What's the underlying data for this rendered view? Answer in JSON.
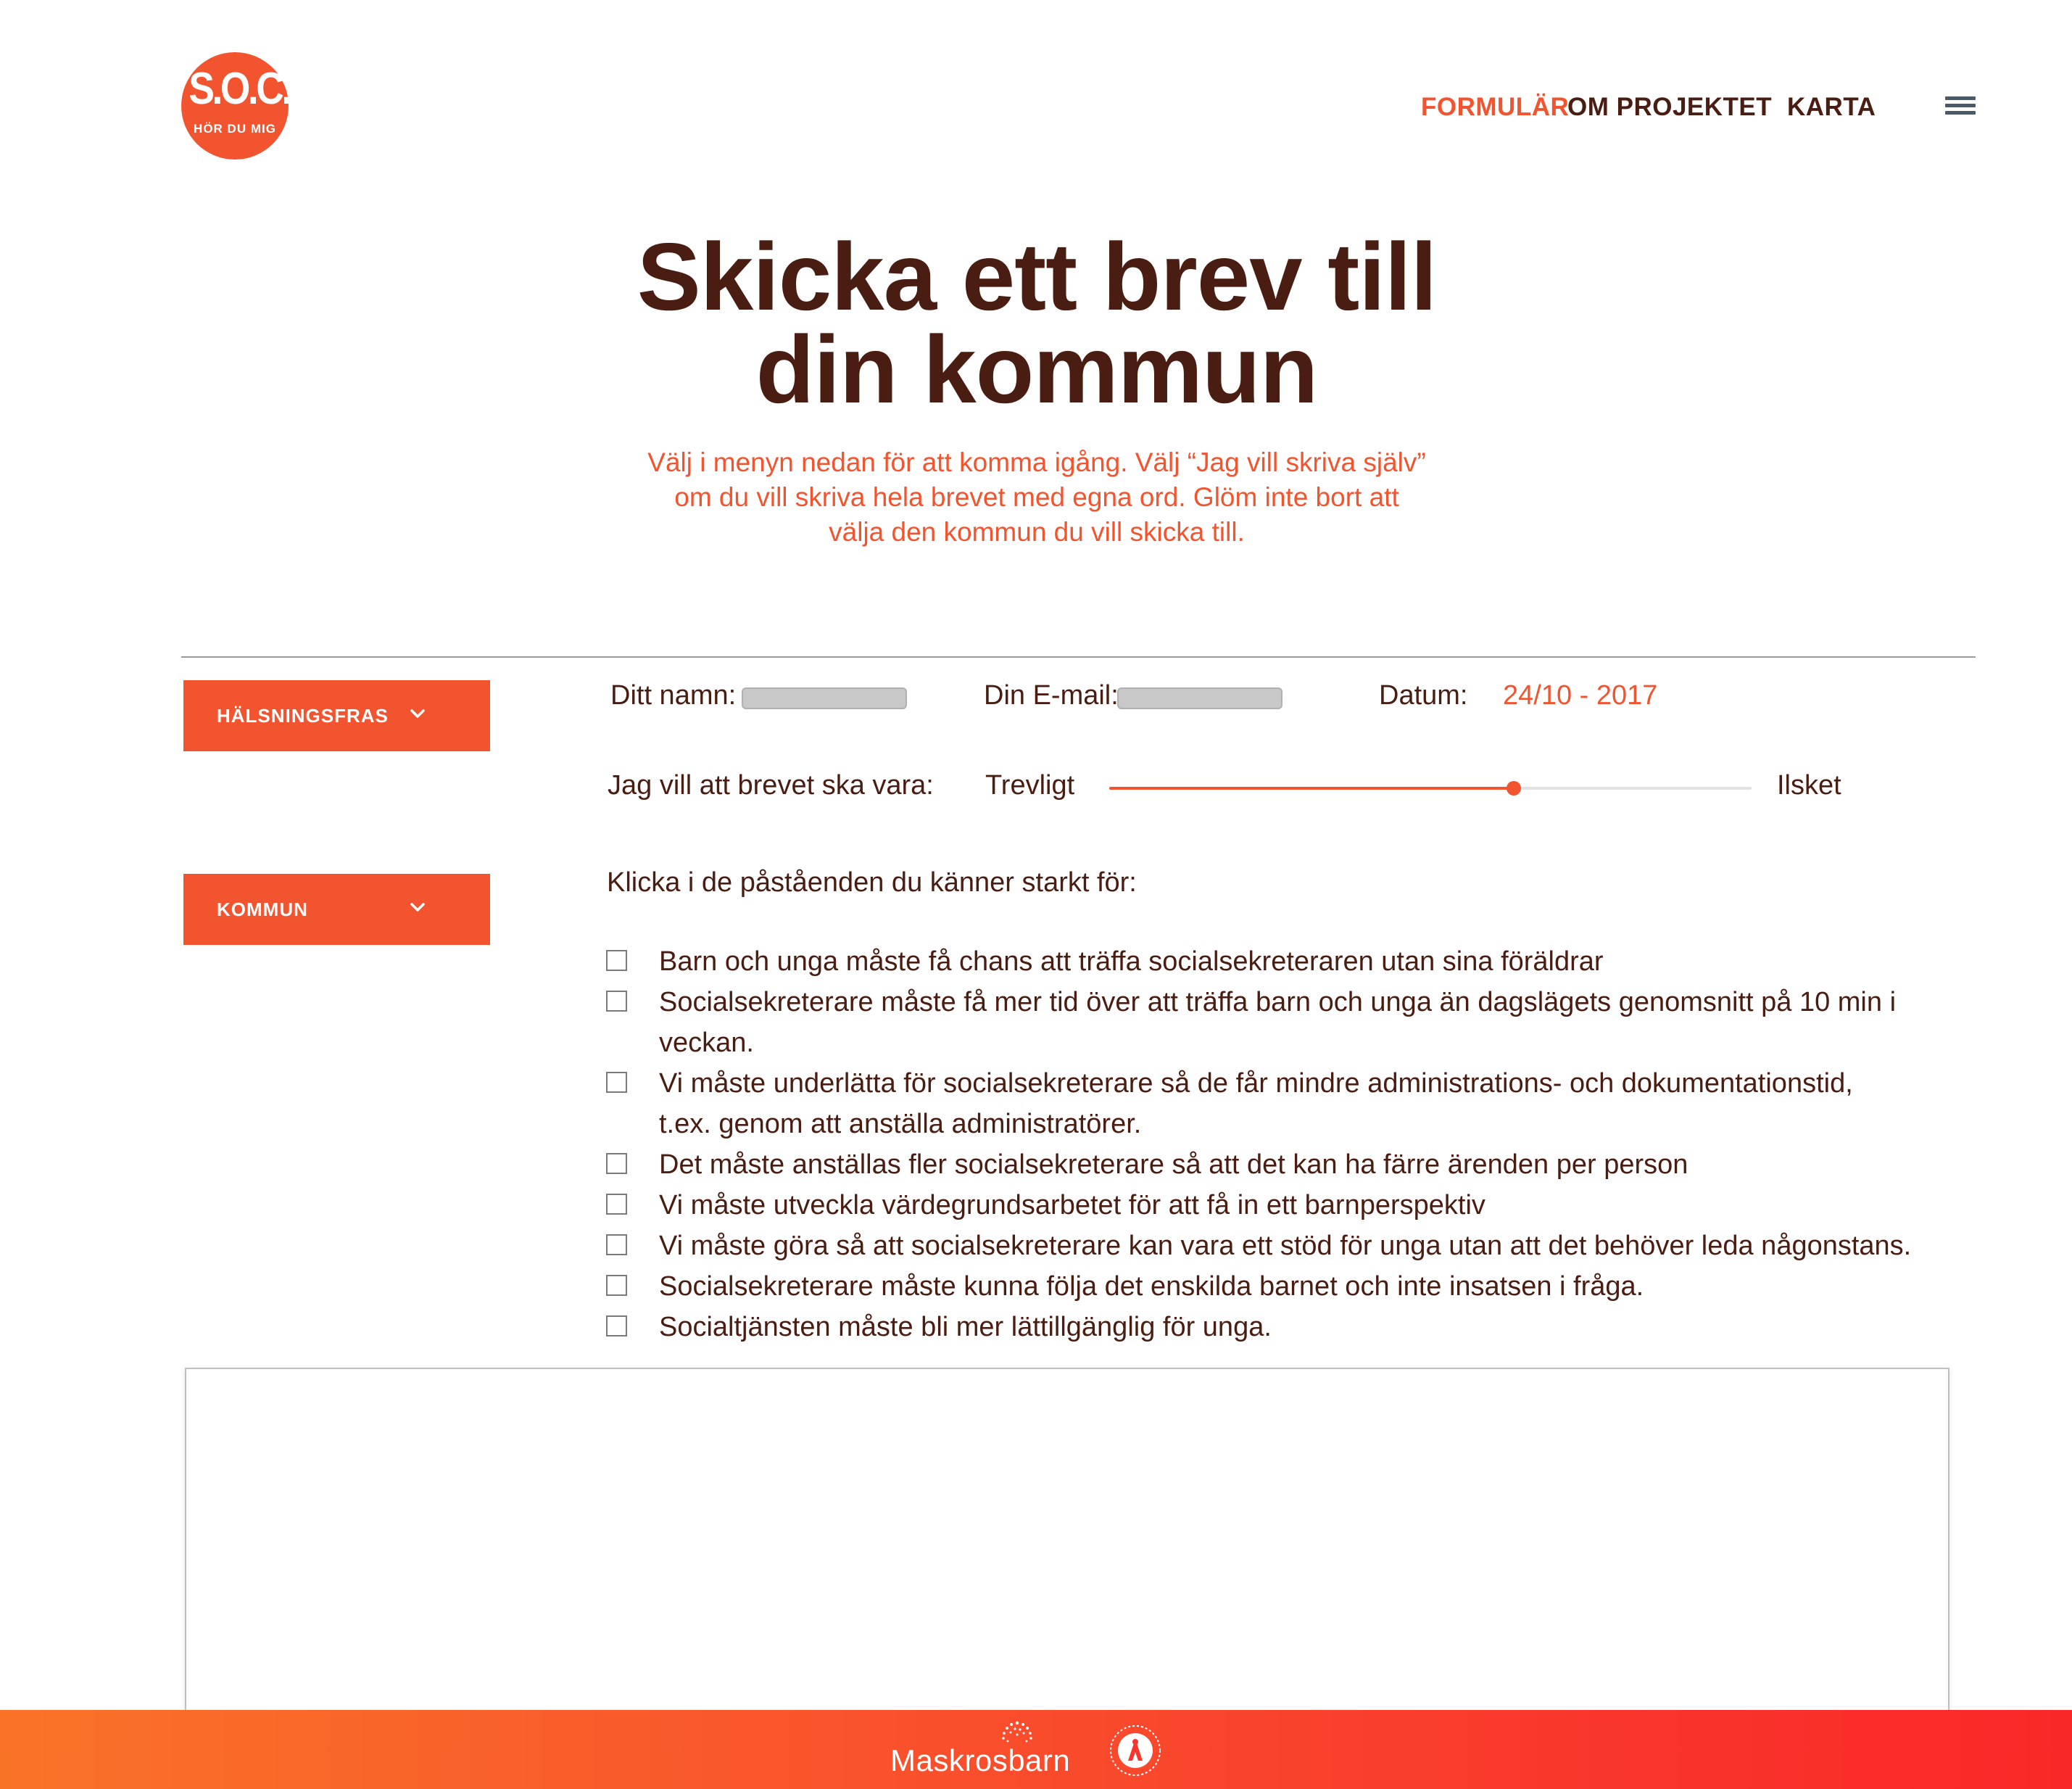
{
  "header": {
    "logo_big": "S.O.C.",
    "logo_small": "HÖR DU MIG",
    "nav": [
      {
        "label": "FORMULÄR",
        "active": true
      },
      {
        "label": "OM PROJEKTET",
        "active": false
      },
      {
        "label": "KARTA",
        "active": false
      }
    ],
    "menu_icon": "hamburger-icon"
  },
  "hero": {
    "title_line1": "Skicka ett brev till",
    "title_line2": "din kommun",
    "intro_line1": "Välj i menyn nedan för att komma igång. Välj “Jag vill skriva själv”",
    "intro_line2": "om du vill skriva hela brevet med egna ord. Glöm inte bort att",
    "intro_line3": "välja den kommun du vill skicka till."
  },
  "sidebar": {
    "dropdowns": [
      {
        "label": "HÄLSNINGSFRAS",
        "icon": "chevron-down-icon"
      },
      {
        "label": "KOMMUN",
        "icon": "chevron-down-icon"
      }
    ]
  },
  "form": {
    "name_label": "Ditt namn:",
    "name_value": "",
    "email_label": "Din E-mail:",
    "email_value": "",
    "date_label": "Datum:",
    "date_value": "24/10 - 2017",
    "tone_label": "Jag vill att brevet ska vara:",
    "tone_min_label": "Trevligt",
    "tone_max_label": "Ilsket",
    "tone_value": 0.63
  },
  "statements": {
    "prompt": "Klicka i de påståenden du känner starkt för:",
    "items": [
      "Barn och unga måste få chans att träffa socialsekreteraren utan sina föräldrar",
      "Socialsekreterare måste få mer tid över att träffa barn och unga än dagslägets genomsnitt på 10 min i veckan.",
      "Vi måste underlätta för socialsekreterare så de får mindre administrations- och dokumentationstid,",
      "t.ex. genom att anställa administratörer.",
      "Det måste anställas fler socialsekreterare så att det kan ha färre ärenden per person",
      "Vi måste utveckla värdegrundsarbetet för att få in ett barnperspektiv",
      "Vi måste göra så att socialsekreterare kan vara ett stöd för unga utan att det behöver leda någonstans.",
      "Socialsekreterare måste kunna följa det enskilda barnet och inte insatsen i fråga.",
      "Socialtjänsten måste bli mer lättillgänglig för unga."
    ]
  },
  "letter": {
    "value": ""
  },
  "footer": {
    "brand": "Maskrosbarn",
    "partner_icon": "partner-seal-icon",
    "colors": {
      "start": "#f97327",
      "end": "#f92828"
    }
  },
  "colors": {
    "accent": "#f2542f",
    "text": "#4a1d12"
  }
}
